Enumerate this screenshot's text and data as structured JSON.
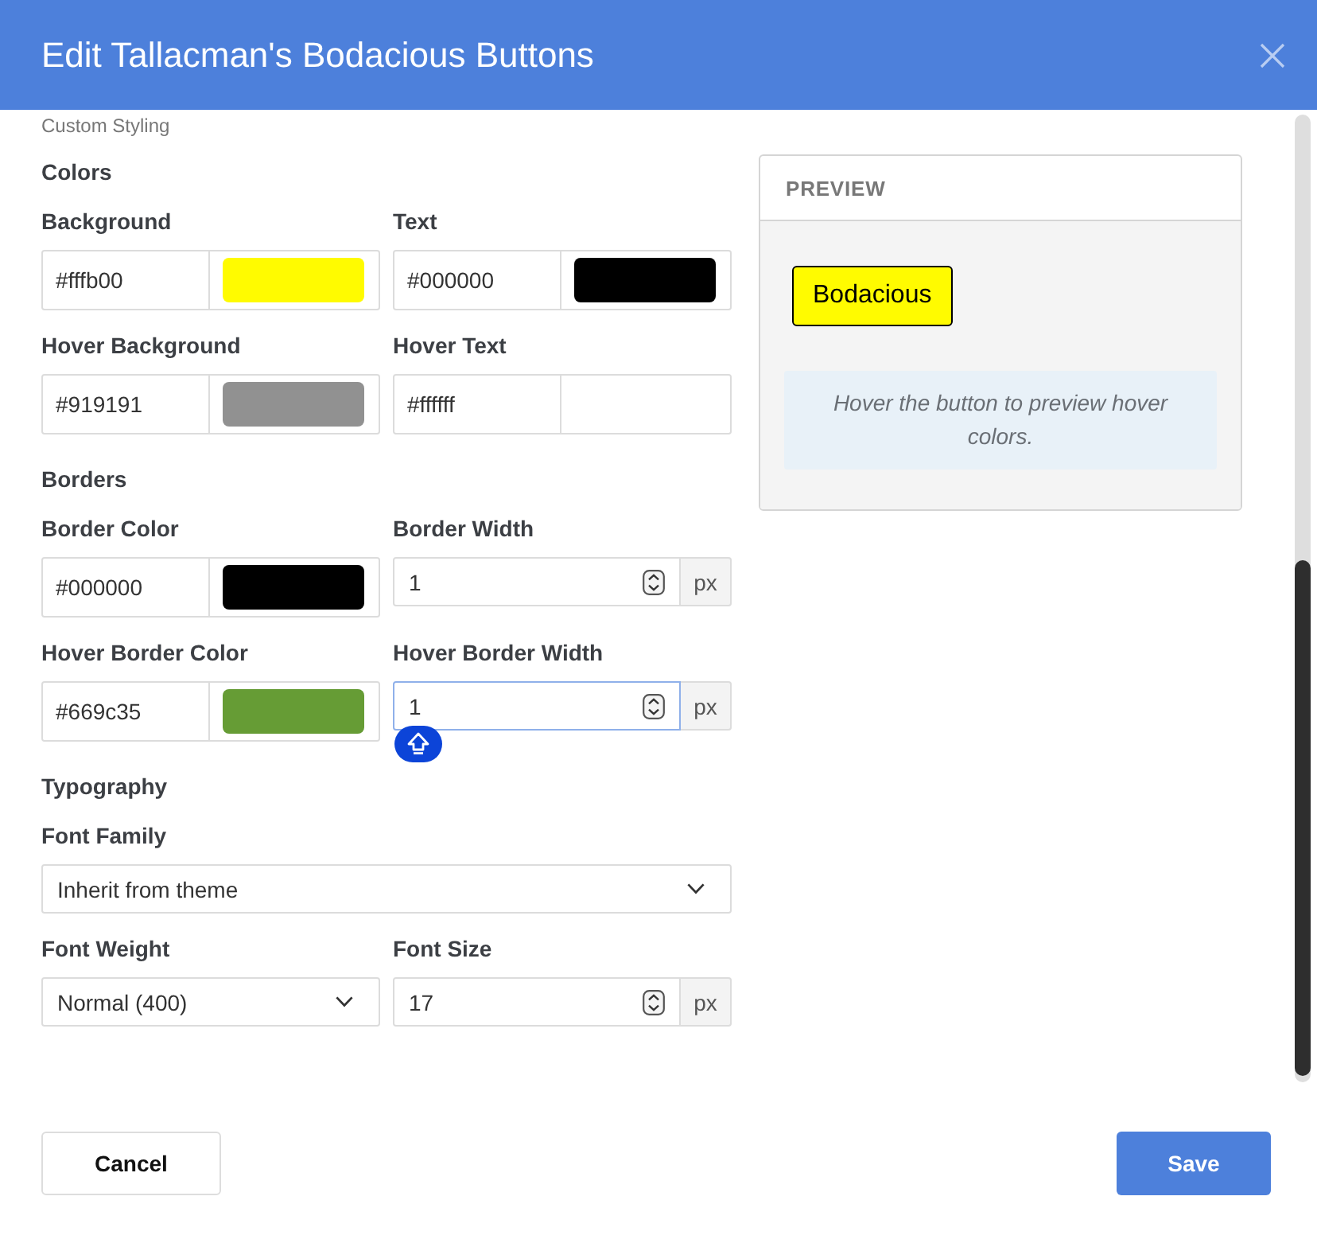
{
  "dialog": {
    "title": "Edit Tallacman's Bodacious Buttons"
  },
  "form": {
    "caption": "Custom Styling",
    "sections": [
      {
        "heading": "Colors",
        "rows": [
          [
            {
              "kind": "color",
              "label": "Background",
              "value": "#fffb00",
              "color": "#fffb00",
              "focused": false
            },
            {
              "kind": "color",
              "label": "Text",
              "value": "#000000",
              "color": "#000000",
              "focused": false
            }
          ],
          [
            {
              "kind": "color",
              "label": "Hover Background",
              "value": "#919191",
              "color": "#919191",
              "focused": false
            },
            {
              "kind": "color",
              "label": "Hover Text",
              "value": "#ffffff",
              "color": "#ffffff",
              "focused": false
            }
          ]
        ]
      },
      {
        "heading": "Borders",
        "rows": [
          [
            {
              "kind": "color",
              "label": "Border Color",
              "value": "#000000",
              "color": "#000000",
              "focused": false
            },
            {
              "kind": "number",
              "label": "Border Width",
              "value": "1",
              "unit": "px",
              "focused": false
            }
          ],
          [
            {
              "kind": "color",
              "label": "Hover Border Color",
              "value": "#669c35",
              "color": "#669c35",
              "focused": false
            },
            {
              "kind": "number",
              "label": "Hover Border Width",
              "value": "1",
              "unit": "px",
              "focused": true
            }
          ]
        ]
      },
      {
        "heading": "Typography",
        "rows": [
          [
            {
              "kind": "select",
              "label": "Font Family",
              "value": "Inherit from theme",
              "focused": false
            }
          ],
          [
            {
              "kind": "select",
              "label": "Font Weight",
              "value": "Normal (400)",
              "focused": false
            },
            {
              "kind": "number",
              "label": "Font Size",
              "value": "17",
              "unit": "px",
              "focused": false
            }
          ]
        ]
      }
    ]
  },
  "preview": {
    "heading": "PREVIEW",
    "button_label": "Bodacious",
    "hint": "Hover the button to preview hover colors."
  },
  "footer": {
    "buttons": [
      {
        "kind": "secondary",
        "label": "Cancel"
      },
      {
        "kind": "primary",
        "label": "Save"
      }
    ]
  }
}
